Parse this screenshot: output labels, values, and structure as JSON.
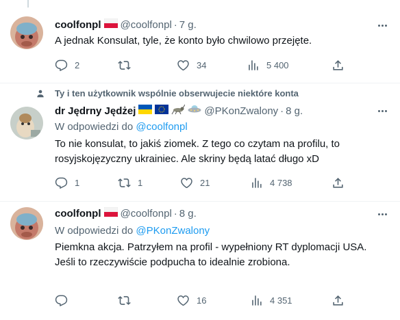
{
  "tweets": [
    {
      "name": "coolfonpl",
      "handle": "@coolfonpl",
      "time": "7 g.",
      "text": "A jednak Konsulat, tyle, że konto było chwilowo przejęte.",
      "replies": "2",
      "retweets": "",
      "likes": "34",
      "views": "5 400"
    },
    {
      "social_context": "Ty i ten użytkownik wspólnie obserwujecie niektóre konta",
      "name": "dr Jędrny Jędżej",
      "handle": "@PKonZwalony",
      "time": "8 g.",
      "replying_prefix": "W odpowiedzi do ",
      "replying_to": "@coolfonpl",
      "text": "To nie konsulat, to jakiś ziomek. Z tego co czytam na profilu, to rosyjskojęzyczny ukrainiec. Ale skriny będą latać długo xD",
      "replies": "1",
      "retweets": "1",
      "likes": "21",
      "views": "4 738"
    },
    {
      "name": "coolfonpl",
      "handle": "@coolfonpl",
      "time": "8 g.",
      "replying_prefix": "W odpowiedzi do ",
      "replying_to": "@PKonZwalony",
      "text": "Piemkna akcja. Patrzyłem na profil - wypełniony RT dyplomacji USA.\nJeśli to rzeczywiście podpucha to idealnie zrobiona.",
      "replies": "",
      "retweets": "",
      "likes": "16",
      "views": "4 351"
    }
  ],
  "separator": "·",
  "colors": {
    "text": "#0f1419",
    "secondary": "#536471",
    "link": "#1d9bf0",
    "divider": "#eff3f4"
  },
  "icons": [
    "reply-icon",
    "retweet-icon",
    "like-icon",
    "views-icon",
    "share-icon",
    "more-icon",
    "person-icon",
    "poland-flag",
    "ukraine-flag",
    "eu-flag",
    "grasshopper-emoji",
    "ufo-emoji"
  ]
}
